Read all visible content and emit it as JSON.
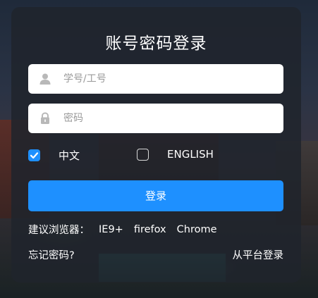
{
  "login": {
    "title": "账号密码登录",
    "username_placeholder": "学号/工号",
    "password_placeholder": "密码",
    "lang_zh": "中文",
    "lang_en": "ENGLISH",
    "lang_zh_checked": true,
    "lang_en_checked": false,
    "submit_label": "登录",
    "browser_hint_label": "建议浏览器：",
    "browsers": [
      "IE9+",
      "firefox",
      "Chrome"
    ],
    "forgot_password": "忘记密码?",
    "platform_login": "从平台登录"
  },
  "colors": {
    "accent": "#1e90ff",
    "panel": "#20242c"
  },
  "icons": [
    "user-icon",
    "lock-icon",
    "check-icon"
  ]
}
